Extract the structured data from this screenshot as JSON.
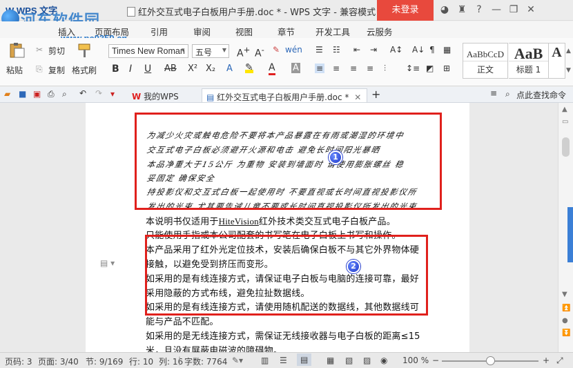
{
  "titlebar": {
    "app_menu": "W WPS 文字",
    "watermark": "河东软件园",
    "watermark_url": "www.pc0359.cn",
    "doc_title": "红外交互式电子白板用户手册.doc * - WPS 文字 - 兼容模式",
    "login": "未登录",
    "icons": [
      "skin-icon",
      "shirt-icon",
      "help-icon",
      "minimize-icon",
      "restore-icon",
      "close-icon"
    ]
  },
  "tabs": [
    "插入",
    "页面布局",
    "引用",
    "审阅",
    "视图",
    "章节",
    "开发工具",
    "云服务"
  ],
  "ribbon": {
    "paste": "粘贴",
    "cut": "剪切",
    "copy": "复制",
    "format_painter": "格式刷",
    "font_name": "Times New Roman",
    "font_size": "五号",
    "styles": [
      {
        "sample": "AaBbCcD",
        "label": "正文"
      },
      {
        "sample": "AaB",
        "label": "标题 1"
      },
      {
        "sample": "A",
        "label": ""
      }
    ]
  },
  "qbar": {
    "tab_mywps": "我的WPS",
    "tab_doc": "红外交互式电子白板用户手册.doc *",
    "search": "点此查找命令"
  },
  "document": {
    "handwritten": [
      "为减少火灾或触电危险不要将本产品暴露在有雨或潮湿的环境中 ",
      "交互式电子白板必须避开火源和电击 避免长时间阳光暴晒 ",
      "本品净重大于15公斤 为重物 安装到墙面时 请使用膨胀螺丝 稳",
      "妥固定 确保安全",
      "持投影仪和交互式白板一起使用时 不要直视或长时间直视投影仪所",
      "发出的光束 尤其要告诫儿童不要或长时间直视投影仪所发出的光束"
    ],
    "line_1_prefix": "本说明书仅适用于",
    "line_1_brand": "HiteVision",
    "line_1_suffix": "红外技术类交互式电子白板产品。",
    "lines": [
      "只能使用手指或本公司配套的书写笔在电子白板上书写和操作。",
      "本产品采用了红外光定位技术，安装后确保白板不与其它外界物体硬",
      "接触，以避免受到挤压而变形。",
      "如采用的是有线连接方式，请保证电子白板与电脑的连接可靠，最好",
      "采用隐蔽的方式布线，避免拉扯数据线。",
      "如采用的是有线连接方式，请使用随机配送的数据线，其他数据线可",
      "能与产品不匹配。",
      "如采用的是无线连接方式，需保证无线接收器与电子白板的距离≤15",
      "米，且没有屏蔽电磁波的障碍物。"
    ],
    "badges": [
      "1",
      "2"
    ]
  },
  "status": {
    "page_num": "页码: 3",
    "pages": "页面: 3/40",
    "section": "节: 9/169",
    "row": "行: 10",
    "col": "列: 16",
    "words": "字数: 7764",
    "zoom": "100 %",
    "zoom_fraction": 0.5
  },
  "colors": {
    "login_red": "#e8493d",
    "annotation_red": "#e0201c",
    "badge_blue": "#1d36c9",
    "watermark_blue": "#2a78c8"
  }
}
